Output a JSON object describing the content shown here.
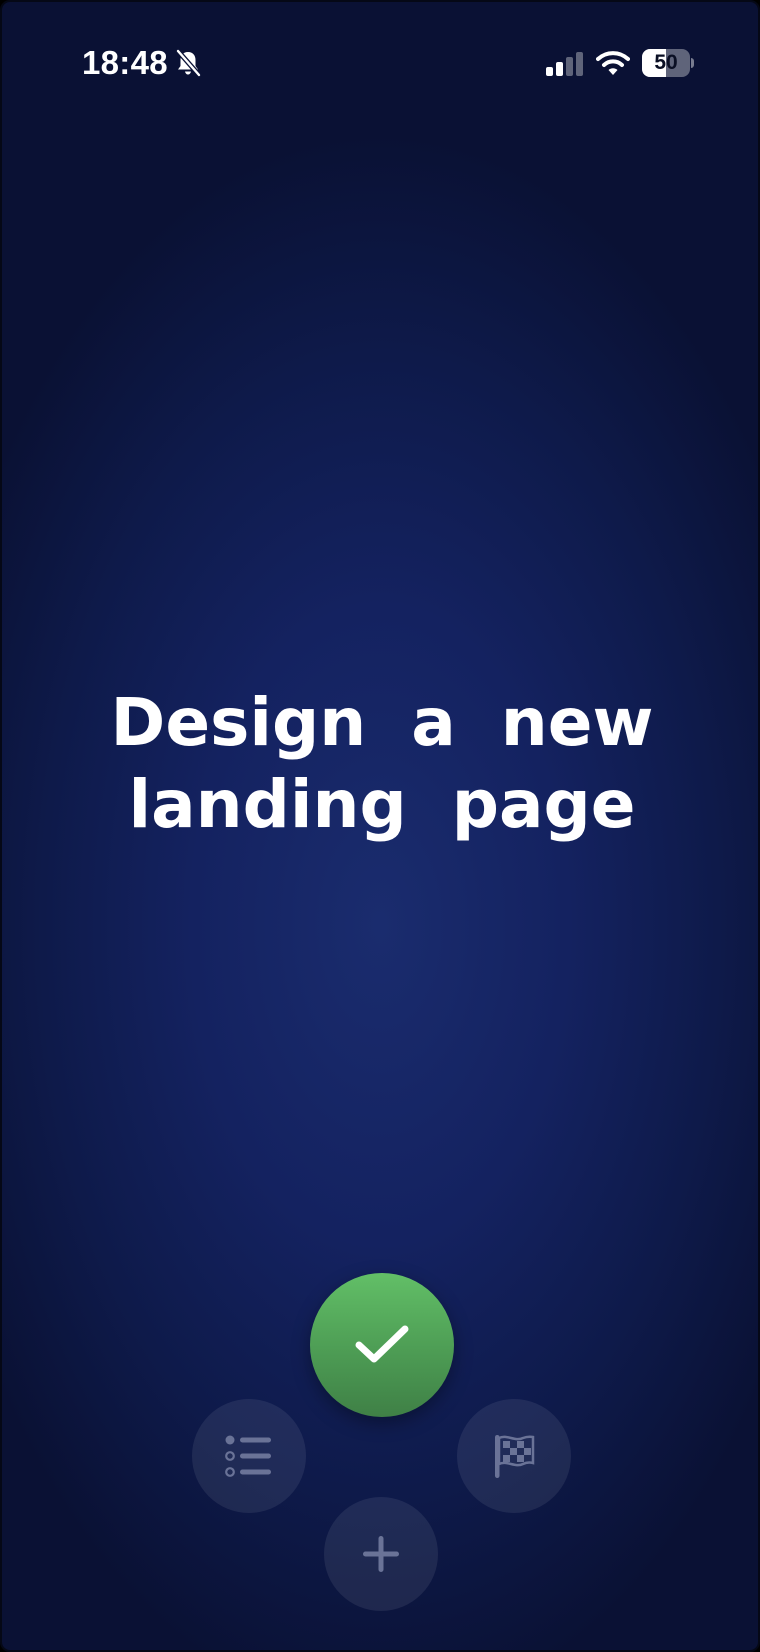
{
  "status_bar": {
    "time": "18:48",
    "silent_mode_icon": "bell-slash-icon",
    "cellular_icon": "cellular-signal-icon",
    "wifi_icon": "wifi-icon",
    "battery_level": "50"
  },
  "task": {
    "title": "Design a new landing page"
  },
  "actions": {
    "complete_icon": "checkmark-icon",
    "list_icon": "list-icon",
    "flag_icon": "checkered-flag-icon",
    "add_icon": "plus-icon"
  },
  "colors": {
    "background": "#142260",
    "complete_button": "#4d9c54",
    "secondary_icon": "#6a7397"
  }
}
